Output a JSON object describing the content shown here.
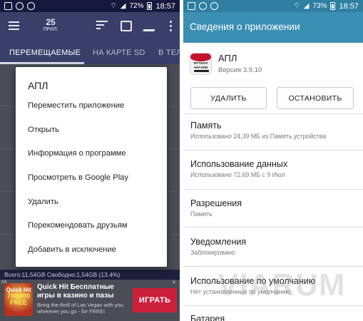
{
  "left": {
    "status": {
      "battery": "72%",
      "time": "18:57"
    },
    "toolbar": {
      "count": "25",
      "count_unit": "ПРИЛ."
    },
    "tabs": [
      {
        "label": "ПЕРЕМЕЩАЕМЫЕ",
        "active": true
      },
      {
        "label": "НА КАРТЕ SD",
        "active": false
      },
      {
        "label": "В ТЕЛ",
        "active": false
      }
    ],
    "dialog": {
      "title": "АПЛ",
      "items": [
        "Переместить приложение",
        "Открыть",
        "Информация о программе",
        "Просмотреть в Google Play",
        "Удалить",
        "Порекомендовать друзьям",
        "Добавить в исключение"
      ]
    },
    "storage": "Всего:11,54GB Свободно:1,54GB (13.4%)",
    "ad": {
      "label": "Ad",
      "logo_top": "Quick Hit",
      "logo_bottom": "700,000 FREE",
      "title": "Quick Hit Бесплатные игры в казино и пазы",
      "text": "Bring the thrill of Las Vegas with you wherever you go - for FREE!",
      "button": "ИГРАТЬ",
      "colors": {
        "button": "#cc1f3a"
      }
    }
  },
  "right": {
    "status": {
      "battery": "73%",
      "time": "18:57"
    },
    "title": "Сведения о приложении",
    "app": {
      "name": "АПЛ",
      "version": "Версия 3.9.10",
      "icon_text": "ФУТБОЛ АНГЛИИ"
    },
    "buttons": {
      "uninstall": "УДАЛИТЬ",
      "stop": "ОСТАНОВИТЬ"
    },
    "sections": [
      {
        "title": "Память",
        "sub": "Использовано 24,39 МБ из Память устройства"
      },
      {
        "title": "Использование данных",
        "sub": "Использовано 72,69 МБ с 9 Июл"
      },
      {
        "title": "Разрешения",
        "sub": "Память"
      },
      {
        "title": "Уведомления",
        "sub": "Заблокировано"
      },
      {
        "title": "Использование по умолчанию",
        "sub": "Нет установленных по умолчанию"
      },
      {
        "title": "Батарея",
        "sub": ""
      }
    ],
    "colors": {
      "appbar": "#3b8fb3",
      "status": "#2f7fa3"
    }
  },
  "watermark": "VIARUM"
}
